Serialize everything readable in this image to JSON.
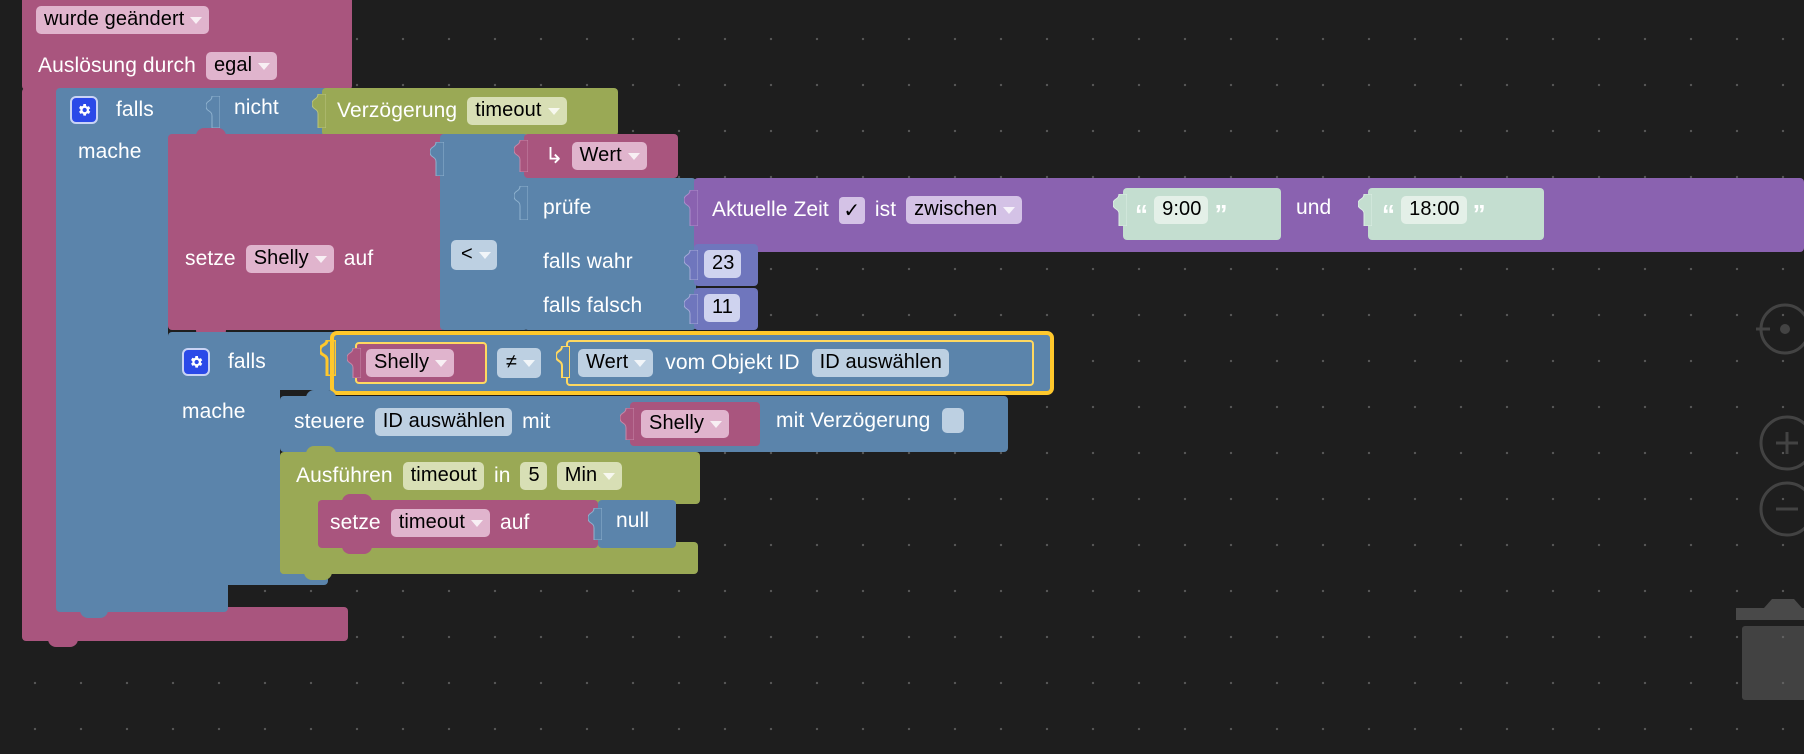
{
  "workspace": {
    "background_color": "#1e1e1e",
    "grid_dot_color": "#555555",
    "selected_highlight_color": "#ffc82c"
  },
  "palette": {
    "pink": "#a9557e",
    "blue": "#5b84ab",
    "green": "#9aa955",
    "purple": "#8a62b0",
    "dark_blue": "#6f76bd",
    "field_pink": "#e0b4cd",
    "field_blue": "#bdd0e2",
    "field_green": "#d8dfb5",
    "field_purple": "#d4c2e6",
    "field_mint": "#e4f0e8"
  },
  "blocks": {
    "trigger": {
      "event_label": "wurde geändert",
      "source_label": "Auslösung durch",
      "source_value": "egal"
    },
    "if_outer": {
      "gear_icon": "gear-icon",
      "if_label": "falls",
      "do_label": "mache",
      "not_label": "nicht",
      "delay_label": "Verzögerung",
      "delay_value": "timeout"
    },
    "set_variable": {
      "set_label": "setze",
      "variable": "Shelly",
      "to_label": "auf"
    },
    "comparison_operator": "<",
    "ternary": {
      "return_arrow": "↳",
      "return_value": "Wert",
      "check_label": "prüfe",
      "if_true_label": "falls wahr",
      "if_true_value": "23",
      "if_false_label": "falls falsch",
      "if_false_value": "11"
    },
    "time_condition": {
      "label": "Aktuelle Zeit",
      "checkmark": "✓",
      "is_label": "ist",
      "operator": "zwischen",
      "open_quote": "“",
      "close_quote": "”",
      "start_time": "9:00",
      "and_label": "und",
      "end_time": "18:00"
    },
    "if_inner": {
      "gear_icon": "gear-icon",
      "if_label": "falls",
      "do_label": "mache",
      "left_operand": "Shelly",
      "operator": "≠",
      "right_value": "Wert",
      "object_label": "vom Objekt ID",
      "object_id": "ID auswählen",
      "selected": true
    },
    "control": {
      "control_label": "steuere",
      "target_id": "ID auswählen",
      "with_label": "mit",
      "value": "Shelly",
      "delay_label": "mit Verzögerung",
      "delay_value": ""
    },
    "schedule": {
      "run_label": "Ausführen",
      "name": "timeout",
      "in_label": "in",
      "amount": "5",
      "unit": "Min"
    },
    "set_timeout": {
      "set_label": "setze",
      "variable": "timeout",
      "to_label": "auf",
      "value": "null"
    }
  },
  "controls": {
    "zoom_center_icon": "zoom-center-icon",
    "zoom_in_icon": "zoom-in-icon",
    "zoom_out_icon": "zoom-out-icon",
    "trash_icon": "trash-icon"
  }
}
